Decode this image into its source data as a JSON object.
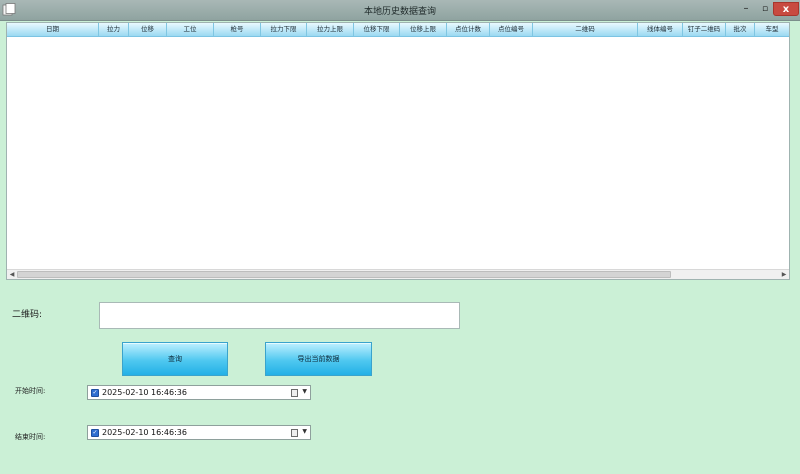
{
  "window": {
    "title": "本地历史数据查询",
    "minimize_label": "–",
    "maximize_label": "▫",
    "close_label": "x"
  },
  "grid": {
    "columns": [
      "日期",
      "拉力",
      "位移",
      "工位",
      "枪号",
      "拉力下限",
      "拉力上限",
      "位移下限",
      "位移上限",
      "点位计数",
      "点位编号",
      "二维码",
      "线体编号",
      "钉子二维码",
      "批次",
      "车型"
    ],
    "rows": []
  },
  "form": {
    "qr_label": "二维码:",
    "qr_value": "",
    "query_button": "查询",
    "export_button": "导出当前数据",
    "start_label": "开始时间:",
    "end_label": "结束时间:",
    "start_value": "2025-02-10 16:46:36",
    "end_value": "2025-02-10 16:46:36",
    "start_checked": true,
    "end_checked": true
  },
  "icons": {
    "app": "app-icon",
    "calendar": "calendar-icon",
    "dropdown": "chevron-down-icon",
    "scroll_left": "chevron-left-icon",
    "scroll_right": "chevron-right-icon"
  },
  "colors": {
    "background": "#cbf0d6",
    "header_gradient_top": "#e9f9ff",
    "header_gradient_bottom": "#9bd9f2",
    "button_accent": "#22b0e6",
    "close_button": "#c84a40"
  }
}
